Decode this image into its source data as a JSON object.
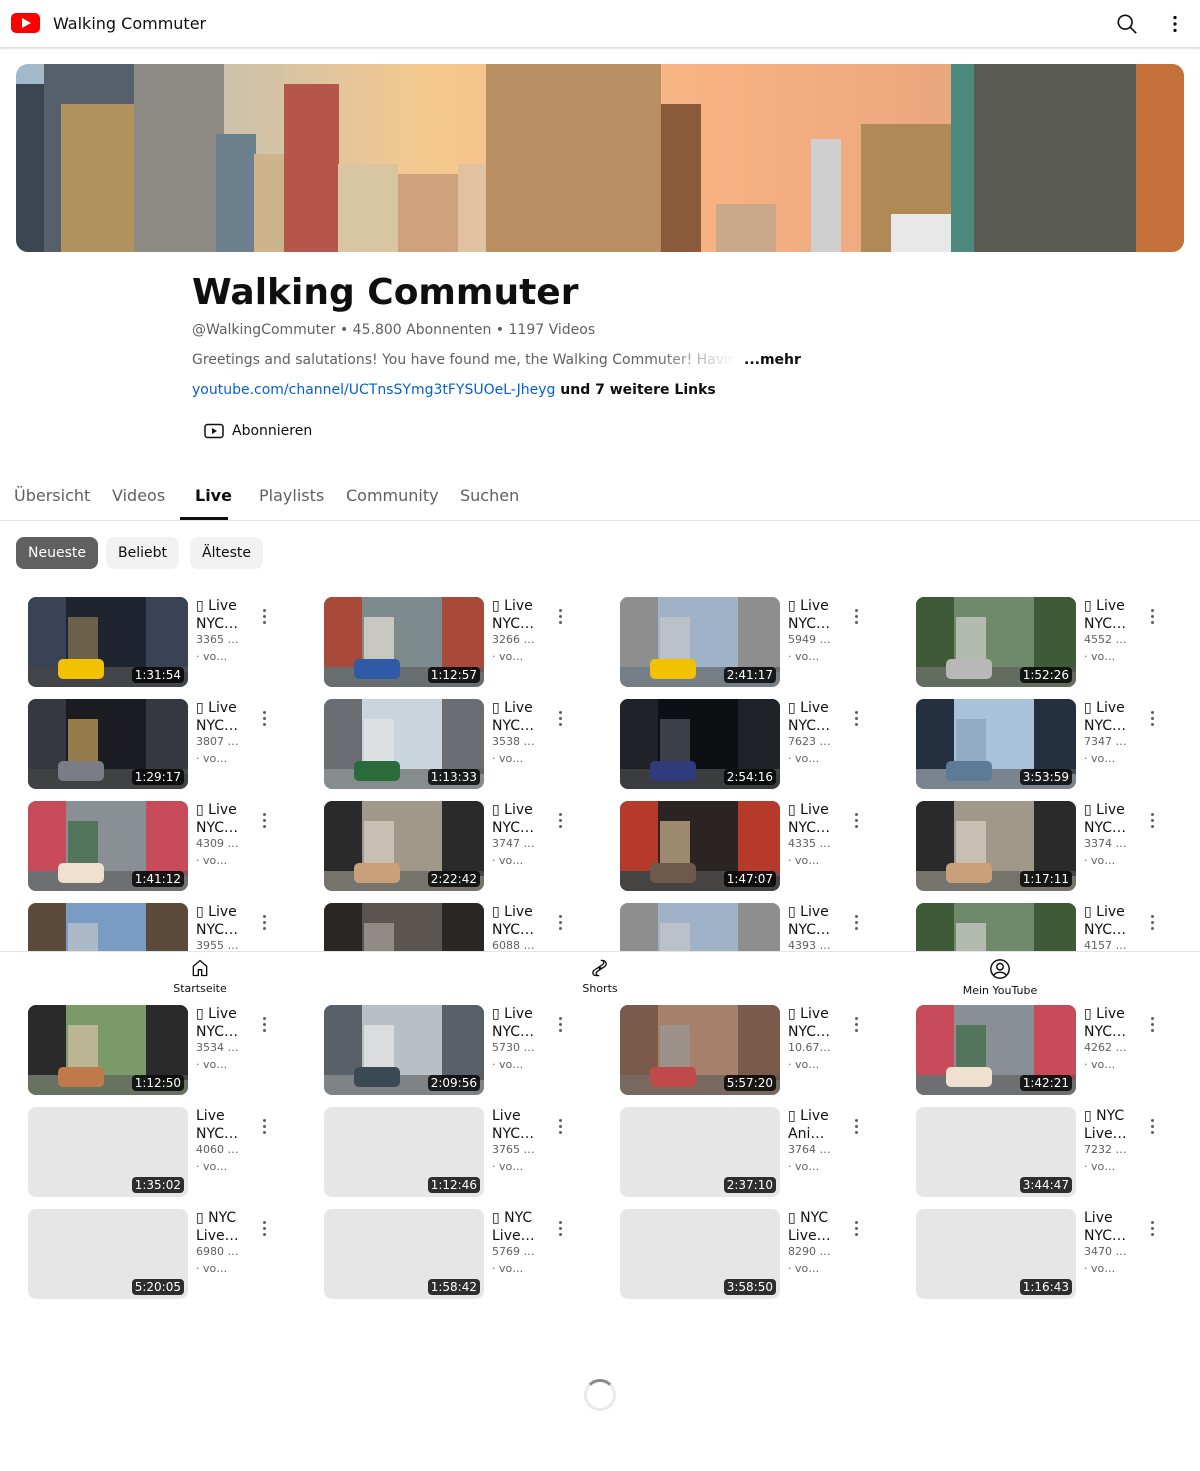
{
  "app": {
    "title": "Walking Commuter"
  },
  "channel": {
    "name": "Walking Commuter",
    "meta": "@WalkingCommuter • 45.800 Abonnenten • 1197 Videos",
    "description": "Greetings and salutations! You have found me, the Walking Commuter! Having lived",
    "more": "...mehr",
    "link_url": "youtube.com/channel/UCTnsSYmg3tFYSUOeL-Jheyg",
    "link_more": " und 7 weitere Links",
    "subscribe": "Abonnieren"
  },
  "tabs": [
    "Übersicht",
    "Videos",
    "Live",
    "Playlists",
    "Community",
    "Suchen"
  ],
  "chips": [
    "Neueste",
    "Beliebt",
    "Älteste"
  ],
  "videos": [
    {
      "l1": "▯ Live",
      "l2": "NYC…",
      "views": "3365 …",
      "ago": "· vo…",
      "duration": "1:31:54",
      "scene": "taxi-night"
    },
    {
      "l1": "▯ Live",
      "l2": "NYC…",
      "views": "3266 …",
      "ago": "· vo…",
      "duration": "1:12:57",
      "scene": "street-bus"
    },
    {
      "l1": "▯ Live",
      "l2": "NYC…",
      "views": "5949 …",
      "ago": "· vo…",
      "duration": "2:41:17",
      "scene": "taxi-day"
    },
    {
      "l1": "▯ Live",
      "l2": "NYC…",
      "views": "4552 …",
      "ago": "· vo…",
      "duration": "1:52:26",
      "scene": "park"
    },
    {
      "l1": "▯ Live",
      "l2": "NYC…",
      "views": "3807 …",
      "ago": "· vo…",
      "duration": "1:29:17",
      "scene": "night-street"
    },
    {
      "l1": "▯ Live",
      "l2": "NYC…",
      "views": "3538 …",
      "ago": "· vo…",
      "duration": "1:13:33",
      "scene": "crossing"
    },
    {
      "l1": "▯ Live",
      "l2": "NYC…",
      "views": "7623 …",
      "ago": "· vo…",
      "duration": "2:54:16",
      "scene": "dark"
    },
    {
      "l1": "▯ Live",
      "l2": "NYC…",
      "views": "7347 …",
      "ago": "· vo…",
      "duration": "3:53:59",
      "scene": "river"
    },
    {
      "l1": "▯ Live",
      "l2": "NYC…",
      "views": "4309 …",
      "ago": "· vo…",
      "duration": "1:41:12",
      "scene": "grand-opening"
    },
    {
      "l1": "▯ Live",
      "l2": "NYC…",
      "views": "3747 …",
      "ago": "· vo…",
      "duration": "2:22:42",
      "scene": "glasses"
    },
    {
      "l1": "▯ Live",
      "l2": "NYC…",
      "views": "4335 …",
      "ago": "· vo…",
      "duration": "1:47:07",
      "scene": "deli"
    },
    {
      "l1": "▯ Live",
      "l2": "NYC…",
      "views": "3374 …",
      "ago": "· vo…",
      "duration": "1:17:11",
      "scene": "glasses"
    },
    {
      "l1": "▯ Live",
      "l2": "NYC…",
      "views": "3955 …",
      "ago": "",
      "duration": "",
      "scene": "bridge-day"
    },
    {
      "l1": "▯ Live",
      "l2": "NYC…",
      "views": "6088 …",
      "ago": "",
      "duration": "",
      "scene": "scaffold"
    },
    {
      "l1": "▯ Live",
      "l2": "NYC…",
      "views": "4393 …",
      "ago": "",
      "duration": "",
      "scene": "taxi-day"
    },
    {
      "l1": "▯ Live",
      "l2": "NYC…",
      "views": "4157 …",
      "ago": "",
      "duration": "",
      "scene": "park"
    },
    {
      "l1": "▯ Live",
      "l2": "NYC…",
      "views": "3534 …",
      "ago": "· vo…",
      "duration": "1:12:50",
      "scene": "phone"
    },
    {
      "l1": "▯ Live",
      "l2": "NYC…",
      "views": "5730 …",
      "ago": "· vo…",
      "duration": "2:09:56",
      "scene": "river-grey"
    },
    {
      "l1": "▯ Live",
      "l2": "NYC…",
      "views": "10.67…",
      "ago": "· vo…",
      "duration": "5:57:20",
      "scene": "brick-street"
    },
    {
      "l1": "▯ Live",
      "l2": "NYC…",
      "views": "4262 …",
      "ago": "· vo…",
      "duration": "1:42:21",
      "scene": "grand-opening"
    },
    {
      "l1": "Live",
      "l2": "NYC…",
      "views": "4060 …",
      "ago": "· vo…",
      "duration": "1:35:02",
      "scene": "blank"
    },
    {
      "l1": "Live",
      "l2": "NYC…",
      "views": "3765 …",
      "ago": "· vo…",
      "duration": "1:12:46",
      "scene": "blank"
    },
    {
      "l1": "▯ Live",
      "l2": "Ani…",
      "views": "3764 …",
      "ago": "· vo…",
      "duration": "2:37:10",
      "scene": "blank"
    },
    {
      "l1": "▯ NYC",
      "l2": "Live…",
      "views": "7232 …",
      "ago": "· vo…",
      "duration": "3:44:47",
      "scene": "blank"
    },
    {
      "l1": "▯ NYC",
      "l2": "Live…",
      "views": "6980 …",
      "ago": "· vo…",
      "duration": "5:20:05",
      "scene": "blank"
    },
    {
      "l1": "▯ NYC",
      "l2": "Live…",
      "views": "5769 …",
      "ago": "· vo…",
      "duration": "1:58:42",
      "scene": "blank"
    },
    {
      "l1": "▯ NYC",
      "l2": "Live…",
      "views": "8290 …",
      "ago": "· vo…",
      "duration": "3:58:50",
      "scene": "blank"
    },
    {
      "l1": "Live",
      "l2": "NYC…",
      "views": "3470 …",
      "ago": "· vo…",
      "duration": "1:16:43",
      "scene": "blank"
    }
  ],
  "bottom_nav": [
    "Startseite",
    "Shorts",
    "Mein YouTube"
  ],
  "colors": {
    "brand": "#ff0000",
    "link": "#065fd4",
    "chip_active": "#606060"
  }
}
